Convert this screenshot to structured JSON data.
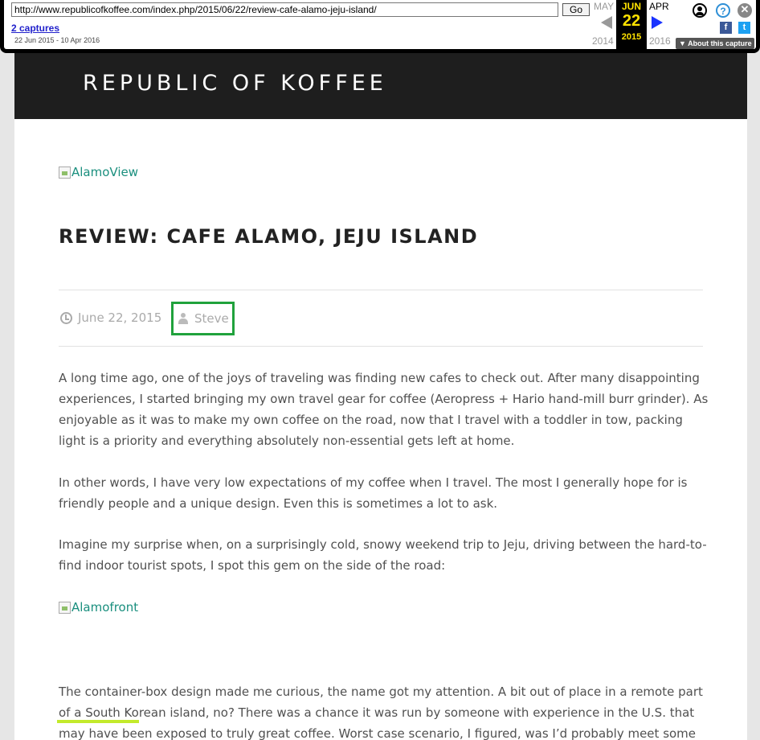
{
  "toolbar": {
    "url": "http://www.republicofkoffee.com/index.php/2015/06/22/review-cafe-alamo-jeju-island/",
    "go_label": "Go",
    "captures_label": "2 captures",
    "date_range": "22 Jun 2015 - 10 Apr 2016",
    "prev": {
      "month": "MAY",
      "year": "2014"
    },
    "current": {
      "month": "JUN",
      "day": "22",
      "year": "2015"
    },
    "next": {
      "month": "APR",
      "year": "2016"
    },
    "about_label": "▼ About this capture",
    "icons": [
      "user-icon",
      "help-icon",
      "close-icon",
      "facebook-icon",
      "twitter-icon"
    ],
    "facebook_glyph": "f",
    "twitter_glyph": "t",
    "help_glyph": "?",
    "close_glyph": "✕"
  },
  "site": {
    "title": "REPUBLIC OF KOFFEE",
    "header_color": "#1e1e1e"
  },
  "post": {
    "image1_alt": "AlamoView",
    "title": "REVIEW: CAFE ALAMO, JEJU ISLAND",
    "date": "June 22, 2015",
    "author": "Steve",
    "paragraphs": [
      "A long time ago, one of the joys of traveling was finding new cafes to check out. After many disappointing experiences, I started bringing my own travel gear for coffee (Aeropress + Hario hand-mill burr grinder). As enjoyable as it was to make my own coffee on the road, now that I travel with a toddler in tow, packing light is a priority and everything absolutely non-essential gets left at home.",
      "In other words, I have very low expectations of my coffee when I travel. The most I generally hope for is friendly people and a unique design. Even this is sometimes a lot to ask.",
      "Imagine my surprise when, on a surprisingly cold, snowy weekend trip to Jeju, driving between the hard-to-find indoor tourist spots, I spot this gem on the side of the road:"
    ],
    "image2_alt": "Alamofront",
    "p4_before": "The container-box design made me curious, the name got my attention. A bit out of place in a remote part of a ",
    "p4_highlight": "South Korean",
    "p4_after": " island, no? There was a chance it was run by someone with experience in the U.S. that may have been exposed to truly great coffee. Worst case scenario, I figured, was I’d probably meet some friendly people"
  },
  "colors": {
    "link": "#1a8f7e",
    "author_box_border": "#20a23c",
    "highlight": "#c3ea2b",
    "wayback_yellow": "#ffe200"
  }
}
